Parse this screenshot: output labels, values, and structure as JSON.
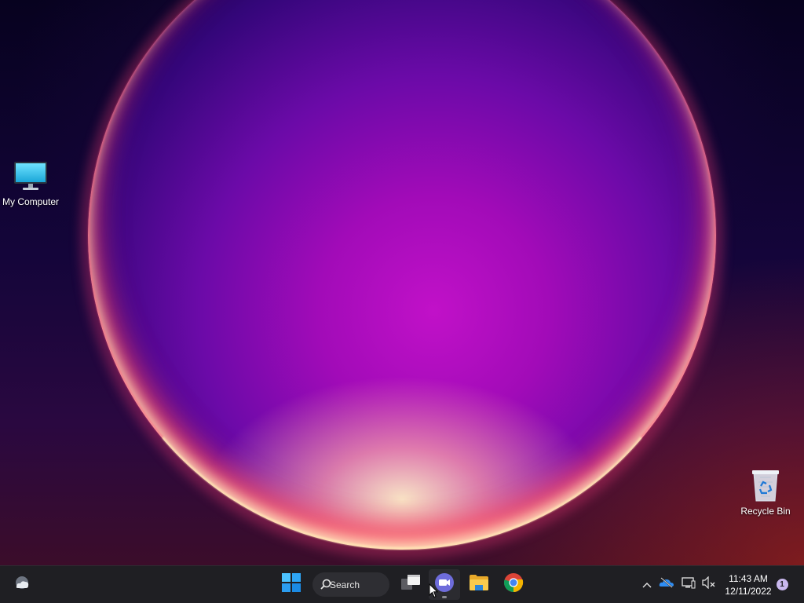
{
  "desktop": {
    "icons": [
      {
        "label": "My Computer",
        "icon": "monitor-icon"
      },
      {
        "label": "Recycle Bin",
        "icon": "recycle-bin-icon"
      }
    ]
  },
  "taskbar": {
    "widgets_icon": "weather-icon",
    "start_icon": "windows-logo-icon",
    "search_label": "Search",
    "apps": [
      {
        "name": "Task View",
        "icon": "task-view-icon"
      },
      {
        "name": "Meet",
        "icon": "video-camera-icon"
      },
      {
        "name": "File Explorer",
        "icon": "folder-icon"
      },
      {
        "name": "Google Chrome",
        "icon": "chrome-icon"
      }
    ],
    "tray": {
      "icons": [
        "chevron-up-icon",
        "onedrive-icon",
        "network-icon",
        "volume-muted-icon"
      ],
      "time": "11:43 AM",
      "date": "12/11/2022",
      "notification_count": "1"
    }
  },
  "colors": {
    "taskbar": "#1f1f23",
    "windows_blue": "#3aa0ff",
    "meet_purple": "#6e6cdb",
    "folder_yellow": "#f5c542"
  }
}
